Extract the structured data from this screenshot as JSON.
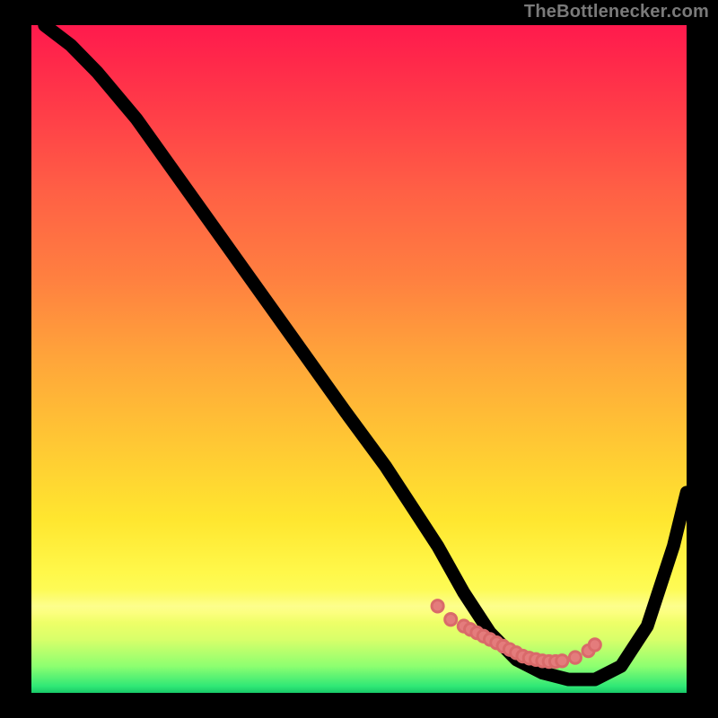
{
  "watermark": "TheBottlenecker.com",
  "colors": {
    "curve": "#000000",
    "dots": "#e47c7c",
    "frame_bg": "#000000"
  },
  "chart_data": {
    "type": "line",
    "title": "",
    "xlabel": "",
    "ylabel": "",
    "xlim": [
      0,
      100
    ],
    "ylim": [
      0,
      100
    ],
    "grid": false,
    "series": [
      {
        "name": "bottleneck-curve",
        "x": [
          2,
          6,
          10,
          16,
          24,
          32,
          40,
          48,
          54,
          58,
          62,
          66,
          70,
          74,
          78,
          82,
          86,
          90,
          94,
          98,
          100
        ],
        "y": [
          100,
          97,
          93,
          86,
          75,
          64,
          53,
          42,
          34,
          28,
          22,
          15,
          9,
          5,
          3,
          2,
          2,
          4,
          10,
          22,
          30
        ]
      }
    ],
    "dots": {
      "name": "optimal-range",
      "x": [
        62,
        64,
        66,
        67,
        68,
        69,
        70,
        71,
        72,
        73,
        74,
        75,
        76,
        77,
        78,
        79,
        80,
        81,
        83,
        85,
        86
      ],
      "y": [
        13,
        11,
        10,
        9.5,
        9,
        8.5,
        8,
        7.5,
        7,
        6.5,
        6,
        5.5,
        5.2,
        5,
        4.8,
        4.7,
        4.7,
        4.8,
        5.3,
        6.3,
        7.2
      ]
    },
    "gradient_stops": [
      {
        "pos": 0,
        "color": "#ff1a4d"
      },
      {
        "pos": 25,
        "color": "#ff6045"
      },
      {
        "pos": 50,
        "color": "#ffa53a"
      },
      {
        "pos": 74,
        "color": "#ffe62f"
      },
      {
        "pos": 92,
        "color": "#d8ff6a"
      },
      {
        "pos": 100,
        "color": "#18c968"
      }
    ]
  }
}
